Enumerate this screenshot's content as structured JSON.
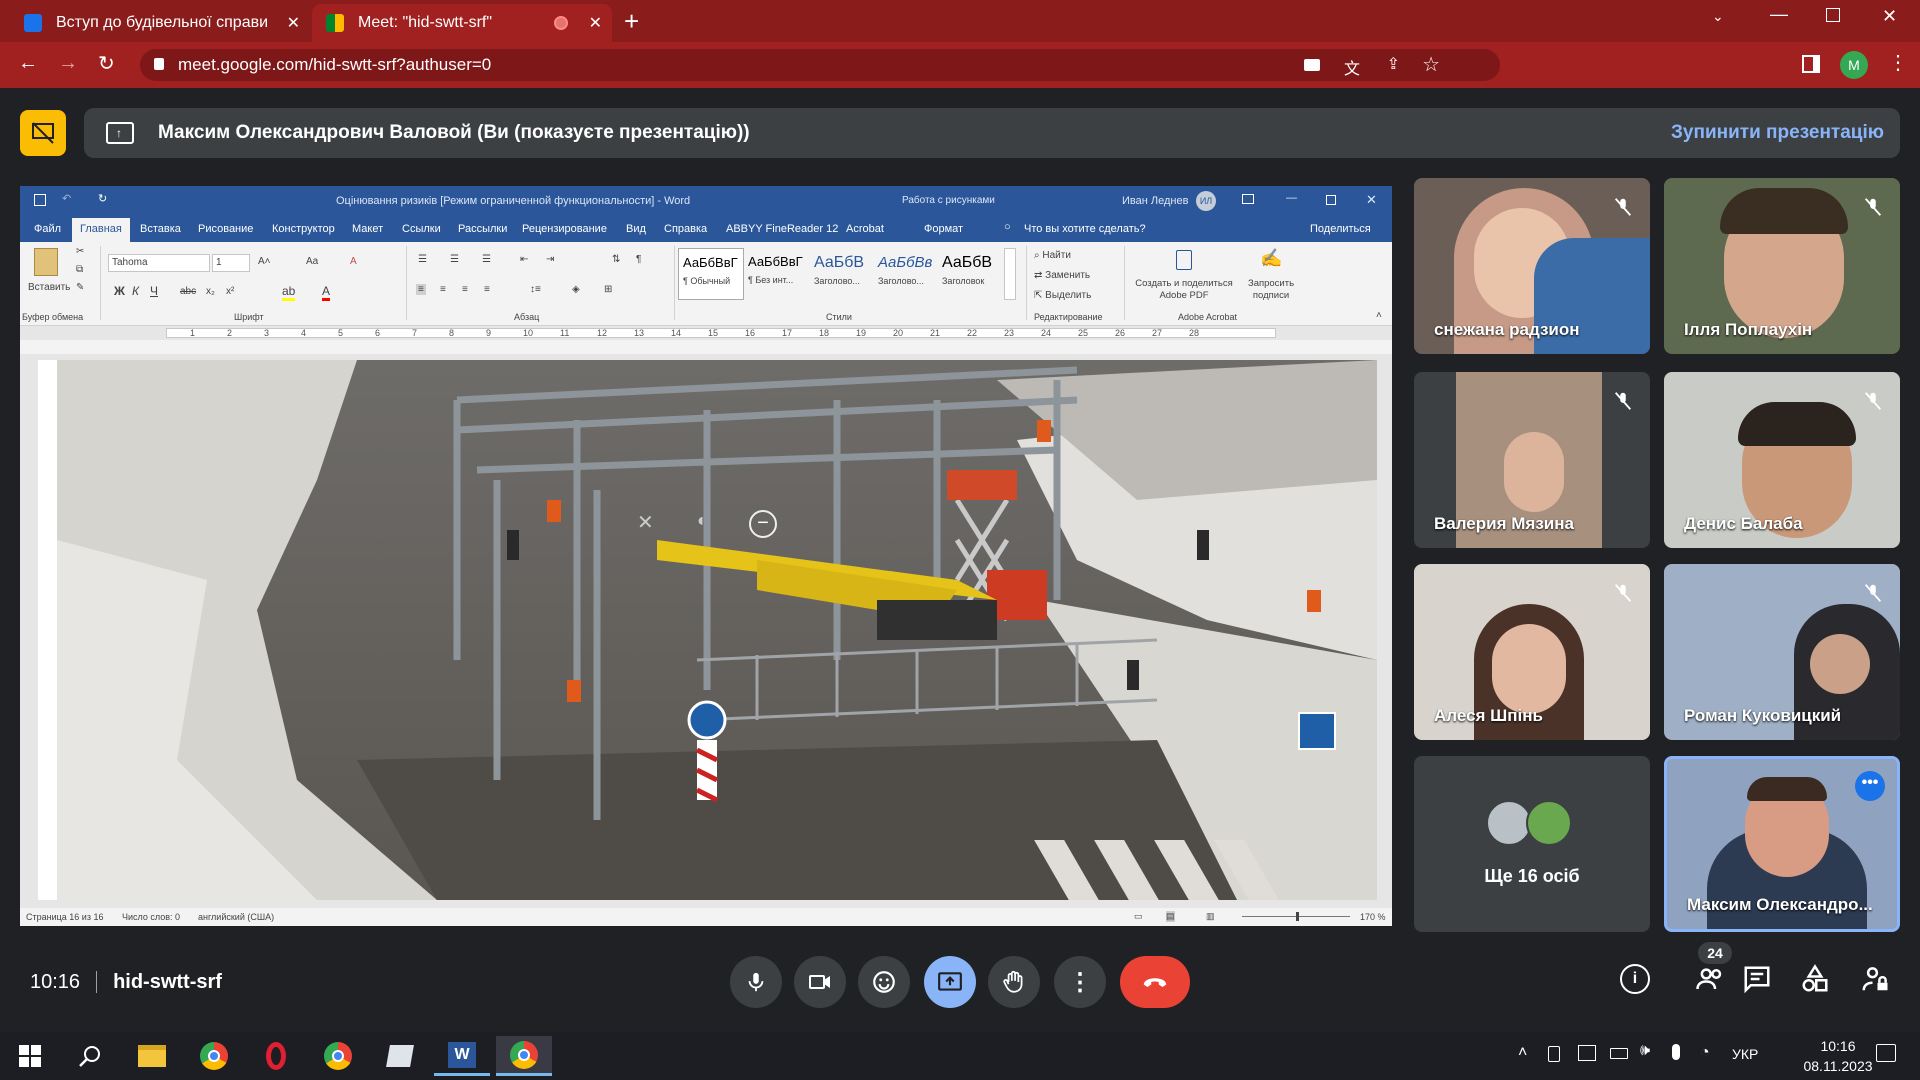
{
  "browser": {
    "tabs": [
      {
        "title": "Вступ до будівельної справи",
        "active": false
      },
      {
        "title": "Meet: \"hid-swtt-srf\"",
        "active": true
      }
    ],
    "url": "meet.google.com/hid-swtt-srf?authuser=0",
    "profile_initial": "M"
  },
  "meet": {
    "presenting_text": "Максим Олександрович Валовой (Ви (показуєте презентацію))",
    "stop_presenting": "Зупинити презентацію",
    "time": "10:16",
    "meeting_code": "hid-swtt-srf",
    "people_count": "24",
    "more_count_label": "Ще 16 осіб",
    "accent": "#8ab4f8",
    "end_call_color": "#ea4335",
    "participants": [
      {
        "name": "снежана радзион",
        "muted": true
      },
      {
        "name": "Ілля Поплаухін",
        "muted": true
      },
      {
        "name": "Валерия Мязина",
        "muted": true
      },
      {
        "name": "Денис Балаба",
        "muted": true
      },
      {
        "name": "Алеся Шпінь",
        "muted": true
      },
      {
        "name": "Роман Куковицкий",
        "muted": true
      },
      {
        "name": "Максим Олександро...",
        "muted": false
      }
    ]
  },
  "word": {
    "title": "Оцінювання ризиків [Режим ограниченной функциональности] - Word",
    "context_tab": "Работа с рисунками",
    "user": "Иван Леднев",
    "user_initials": "ИЛ",
    "menu": [
      "Файл",
      "Главная",
      "Вставка",
      "Рисование",
      "Конструктор",
      "Макет",
      "Ссылки",
      "Рассылки",
      "Рецензирование",
      "Вид",
      "Справка",
      "ABBYY FineReader 12",
      "Acrobat",
      "Формат"
    ],
    "active_menu": "Главная",
    "tell_me": "Что вы хотите сделать?",
    "share": "Поделиться",
    "paste_label": "Вставить",
    "font_name": "Tahoma",
    "font_size": "1",
    "styles": [
      {
        "preview": "АаБбВвГ",
        "label": "¶ Обычный"
      },
      {
        "preview": "АаБбВвГ",
        "label": "¶ Без инт..."
      },
      {
        "preview": "АаБбВ",
        "label": "Заголово..."
      },
      {
        "preview": "АаБбВв",
        "label": "Заголово..."
      },
      {
        "preview": "АаБбВ",
        "label": "Заголовок"
      }
    ],
    "find": "Найти",
    "replace": "Заменить",
    "select": "Выделить",
    "acrobat_create": "Создать и поделиться Adobe PDF",
    "acrobat_sign": "Запросить подписи",
    "groups": [
      "Буфер обмена",
      "Шрифт",
      "Абзац",
      "Стили",
      "Редактирование",
      "Adobe Acrobat"
    ],
    "status": {
      "page": "Страница 16 из 16",
      "words": "Число слов: 0",
      "lang": "английский (США)",
      "zoom": "170 %"
    }
  },
  "taskbar": {
    "lang": "УКР",
    "time": "10:16",
    "date": "08.11.2023"
  }
}
